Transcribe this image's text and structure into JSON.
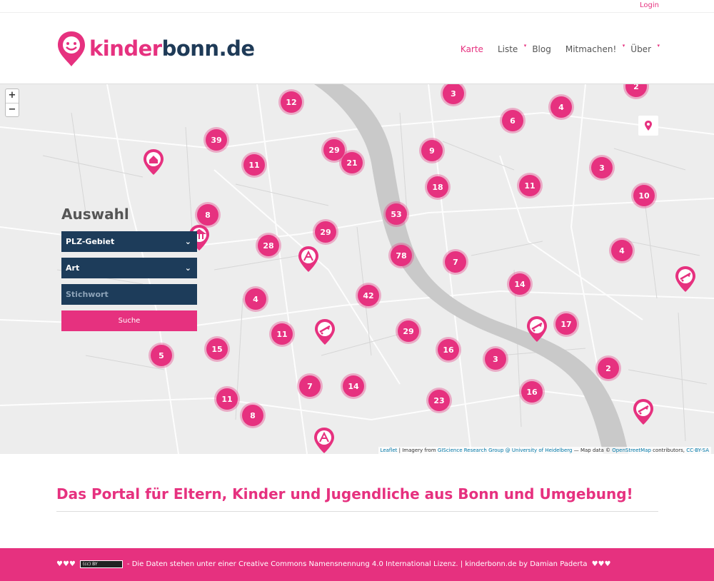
{
  "topbar": {
    "login": "Login"
  },
  "logo": {
    "part1": "kinder",
    "part2": "bonn.de"
  },
  "nav": [
    {
      "label": "Karte",
      "active": true,
      "dropdown": false
    },
    {
      "label": "Liste",
      "active": false,
      "dropdown": true
    },
    {
      "label": "Blog",
      "active": false,
      "dropdown": false
    },
    {
      "label": "Mitmachen!",
      "active": false,
      "dropdown": true
    },
    {
      "label": "Über",
      "active": false,
      "dropdown": true
    }
  ],
  "map": {
    "zoom_in": "+",
    "zoom_out": "−",
    "attribution": {
      "leaflet": "Leaflet",
      "imagery": " | Imagery from ",
      "giscience": "GIScience Research Group @ University of Heidelberg",
      "mapdata": " — Map data © ",
      "osm": "OpenStreetMap",
      "contrib": " contributors, ",
      "license": "CC-BY-SA"
    },
    "clusters": [
      "3",
      "12",
      "2",
      "4",
      "6",
      "39",
      "29",
      "21",
      "9",
      "11",
      "11",
      "3",
      "18",
      "10",
      "8",
      "53",
      "29",
      "28",
      "78",
      "4",
      "7",
      "42",
      "14",
      "4",
      "17",
      "11",
      "29",
      "15",
      "16",
      "3",
      "5",
      "2",
      "7",
      "14",
      "16",
      "11",
      "23",
      "8"
    ]
  },
  "panel": {
    "title": "Auswahl",
    "plz_label": "PLZ-Gebiet",
    "art_label": "Art",
    "keyword_placeholder": "Stichwort",
    "search_label": "Suche"
  },
  "headline": "Das Portal für Eltern, Kinder und Jugendliche aus Bonn und Umgebung!",
  "footer": {
    "hearts_left": "♥♥♥",
    "cc_badge": "(cc) BY",
    "text": "- Die Daten stehen unter einer Creative Commons Namensnennung 4.0 International Lizenz. | kinderbonn.de by Damian Paderta",
    "hearts_right": "♥♥♥"
  },
  "colors": {
    "accent": "#e6317f",
    "navy": "#1d3c5a",
    "brand_dark": "#1e3a57"
  }
}
